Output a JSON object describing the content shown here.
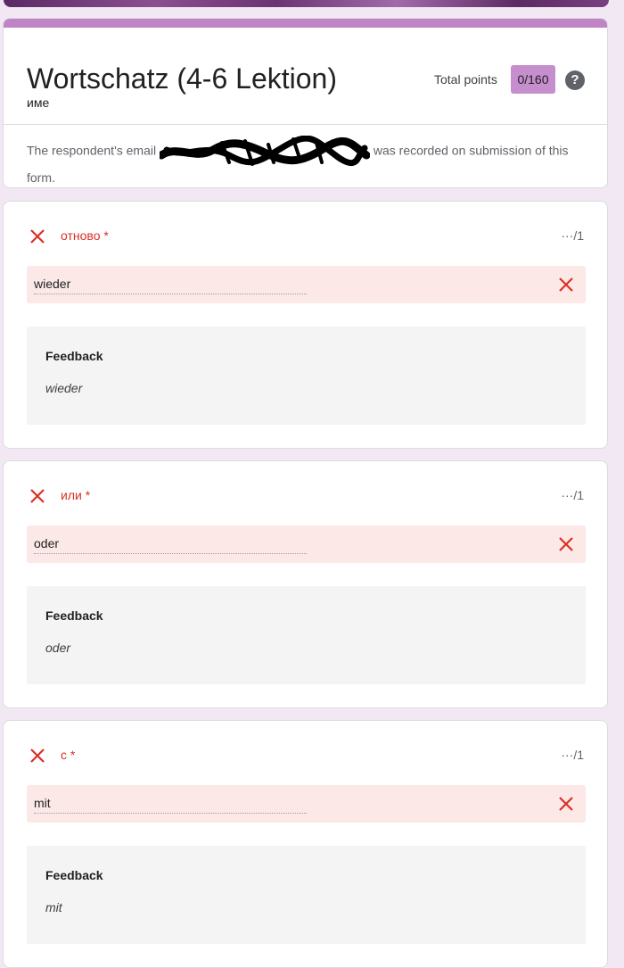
{
  "form": {
    "title": "Wortschatz (4-6 Lektion)",
    "total_points_label": "Total points",
    "total_points_value": "0/160",
    "help_symbol": "?",
    "name_label": "име",
    "email_prefix": "The respondent's email",
    "email_suffix": "was recorded on submission of this form."
  },
  "questions": [
    {
      "title": "отново *",
      "points": "···/1",
      "answer": "wieder",
      "feedback_label": "Feedback",
      "feedback": "wieder"
    },
    {
      "title": "или *",
      "points": "···/1",
      "answer": "oder",
      "feedback_label": "Feedback",
      "feedback": "oder"
    },
    {
      "title": "с *",
      "points": "···/1",
      "answer": "mit",
      "feedback_label": "Feedback",
      "feedback": "mit"
    }
  ],
  "colors": {
    "accent": "#c084c6",
    "error": "#d93025",
    "answer_bg": "#fce8e6",
    "page_bg": "#f1e8f4"
  },
  "icons": [
    "incorrect-x-icon",
    "help-icon",
    "redaction-scribble"
  ]
}
